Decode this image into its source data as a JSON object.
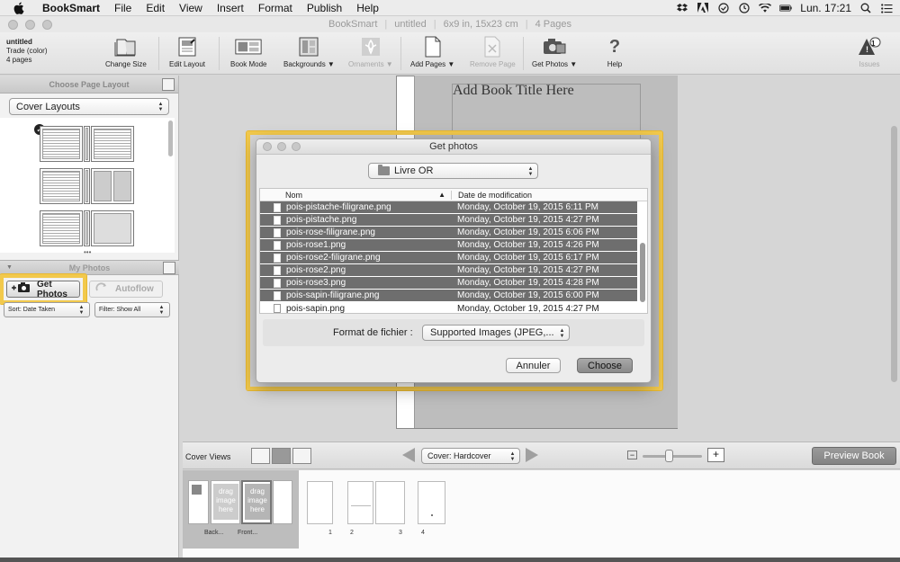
{
  "menubar": {
    "app": "BookSmart",
    "items": [
      "File",
      "Edit",
      "View",
      "Insert",
      "Format",
      "Publish",
      "Help"
    ],
    "clock": "Lun. 17:21"
  },
  "window": {
    "title_parts": [
      "BookSmart",
      "untitled",
      "6x9 in, 15x23 cm",
      "4 Pages"
    ]
  },
  "docinfo": {
    "name": "untitled",
    "format": "Trade (color)",
    "pages": "4 pages"
  },
  "toolbar": {
    "change_size": "Change Size",
    "edit_layout": "Edit Layout",
    "book_mode": "Book Mode",
    "backgrounds": "Backgrounds ▼",
    "ornaments": "Ornaments ▼",
    "add_pages": "Add Pages ▼",
    "remove_page": "Remove Page",
    "get_photos": "Get Photos ▼",
    "help": "Help",
    "issues": "Issues",
    "issues_count": "1"
  },
  "layout_panel": {
    "header": "Choose Page Layout",
    "select": "Cover Layouts"
  },
  "photos_panel": {
    "header": "My Photos",
    "get_photos": "Get Photos",
    "autoflow": "Autoflow",
    "sort": "Sort:  Date Taken",
    "filter": "Filter: Show All"
  },
  "book": {
    "title_placeholder": "Add Book Title Here"
  },
  "dialog": {
    "title": "Get photos",
    "folder": "Livre OR",
    "col_name": "Nom",
    "col_date": "Date de modification",
    "files": [
      {
        "name": "pois-pistache-filigrane.png",
        "date": "Monday, October 19, 2015 6:11 PM",
        "selected": true
      },
      {
        "name": "pois-pistache.png",
        "date": "Monday, October 19, 2015 4:27 PM",
        "selected": true
      },
      {
        "name": "pois-rose-filigrane.png",
        "date": "Monday, October 19, 2015 6:06 PM",
        "selected": true
      },
      {
        "name": "pois-rose1.png",
        "date": "Monday, October 19, 2015 4:26 PM",
        "selected": true
      },
      {
        "name": "pois-rose2-filigrane.png",
        "date": "Monday, October 19, 2015 6:17 PM",
        "selected": true
      },
      {
        "name": "pois-rose2.png",
        "date": "Monday, October 19, 2015 4:27 PM",
        "selected": true
      },
      {
        "name": "pois-rose3.png",
        "date": "Monday, October 19, 2015 4:28 PM",
        "selected": true
      },
      {
        "name": "pois-sapin-filigrane.png",
        "date": "Monday, October 19, 2015 6:00 PM",
        "selected": true
      },
      {
        "name": "pois-sapin.png",
        "date": "Monday, October 19, 2015 4:27 PM",
        "selected": false
      }
    ],
    "format_label": "Format de fichier :",
    "format_value": "Supported Images (JPEG,...",
    "cancel": "Annuler",
    "choose": "Choose"
  },
  "bottombar": {
    "cover_views": "Cover Views",
    "cover_select": "Cover: Hardcover",
    "preview": "Preview Book"
  },
  "strip": {
    "drag_text": "drag image here",
    "back": "Back...",
    "front": "Front...",
    "page_numbers": [
      "1",
      "2",
      "3",
      "4"
    ]
  },
  "colors": {
    "highlight": "#f2c94c",
    "selection": "#6e6e6e"
  }
}
